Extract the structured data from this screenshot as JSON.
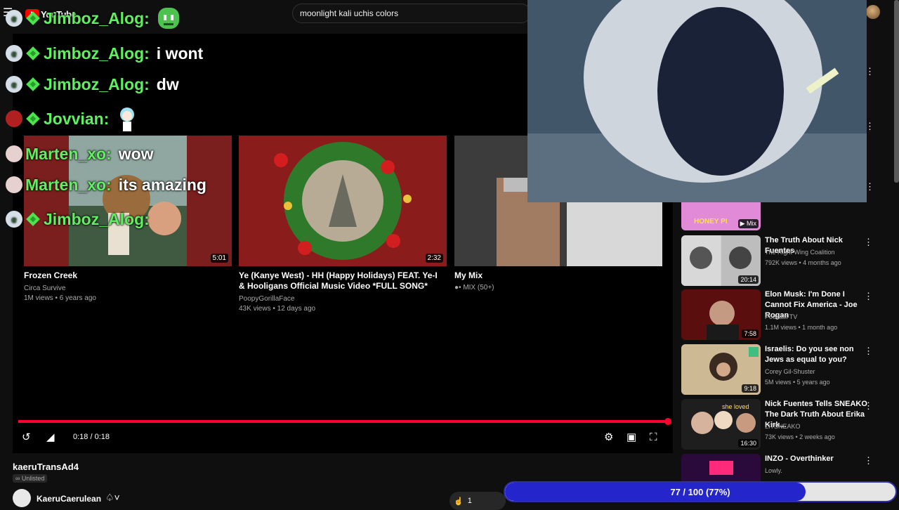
{
  "header": {
    "logo_text": "YouTube",
    "search_query": "moonlight kali uchis colors"
  },
  "chat": [
    {
      "user": "Jimboz_Alog:",
      "message": "",
      "avatar_letter": "e",
      "emote": "green-blob-emote"
    },
    {
      "user": "Jimboz_Alog:",
      "message": "i wont",
      "avatar_letter": "e"
    },
    {
      "user": "Jimboz_Alog:",
      "message": "dw",
      "avatar_letter": "e"
    },
    {
      "user": "Jovvian:",
      "message": "",
      "avatar_letter": "",
      "emote": "anime-girl-emote"
    },
    {
      "user": "Marten_xo:",
      "message": "wow",
      "avatar_letter": ""
    },
    {
      "user": "Marten_xo:",
      "message": "its amazing",
      "avatar_letter": ""
    },
    {
      "user": "Jimboz_Alog:",
      "message": "",
      "avatar_letter": "e"
    }
  ],
  "endscreen": {
    "cards": [
      {
        "title": "Frozen Creek",
        "channel": "Circa Survive",
        "meta": "1M views • 6 years ago",
        "duration": "5:01"
      },
      {
        "title": "Ye (Kanye West) - HH (Happy Holidays) FEAT. Ye-I & Hooligans Official Music Video *FULL SONG*",
        "channel": "PoopyGorillaFace",
        "meta": "43K views • 12 days ago",
        "duration": "2:32"
      },
      {
        "title": "My Mix",
        "channel": "MIX (50+)",
        "meta": "",
        "duration": ""
      }
    ]
  },
  "player": {
    "time": "0:18 / 0:18",
    "progress_fraction": 1.0
  },
  "sidebar": {
    "top_partial": {
      "thumb_text": "HONEY PI",
      "badge": "Mix"
    },
    "items": [
      {
        "title": "The Truth About Nick Fuentes",
        "channel": "The Right Wing Coalition",
        "meta": "792K views • 4 months ago",
        "duration": "20:14"
      },
      {
        "title": "Elon Musk: I'm Done I Cannot Fix America - Joe Rogan",
        "channel": "Podcast TV",
        "meta": "1.1M views • 1 month ago",
        "duration": "7:58"
      },
      {
        "title": "Israelis: Do you see non Jews as equal to you?",
        "channel": "Corey Gil-Shuster",
        "meta": "5M views • 5 years ago",
        "duration": "9:18"
      },
      {
        "title": "Nick Fuentes Tells SNEAKO The Dark Truth About Erika Kirk...",
        "channel": "LITSNEAKO",
        "meta": "73K views • 2 weeks ago",
        "duration": "16:30"
      },
      {
        "title": "INZO - Overthinker",
        "channel": "Lowly.",
        "meta": "",
        "duration": ""
      }
    ]
  },
  "video_info": {
    "title": "kaeruTransAd4",
    "visibility": "Unlisted",
    "channel": "KaeruCaerulean",
    "likes": "1"
  },
  "goal": {
    "text": "77 / 100 (77%)",
    "fraction": 0.77
  },
  "colors": {
    "chat_name_green": "#5ef05e",
    "progress_red": "#ff0033",
    "goal_blue": "#2525cc"
  }
}
